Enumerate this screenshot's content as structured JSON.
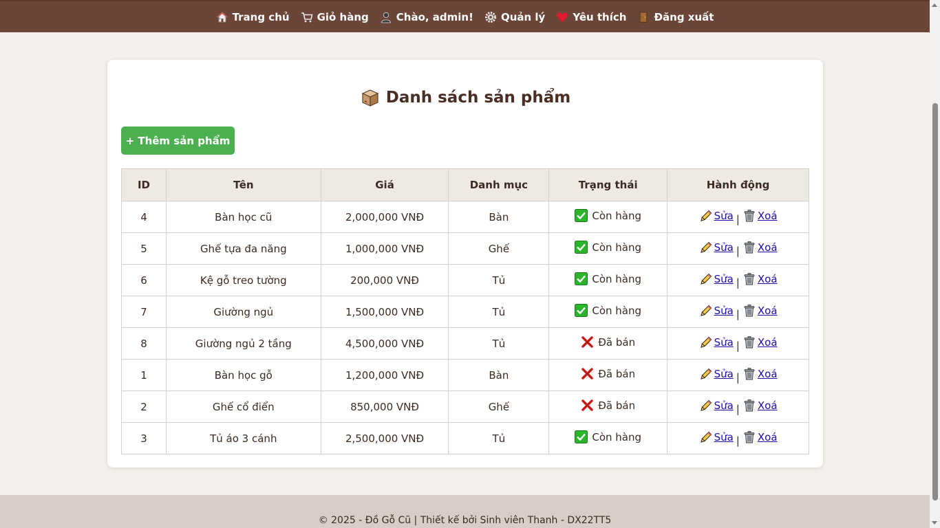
{
  "nav": {
    "items": [
      {
        "label": "Trang chủ",
        "icon": "house-icon"
      },
      {
        "label": "Giỏ hàng",
        "icon": "cart-icon"
      },
      {
        "label": "Chào, admin!",
        "icon": "user-icon"
      },
      {
        "label": "Quản lý",
        "icon": "gear-icon"
      },
      {
        "label": "Yêu thích",
        "icon": "heart-icon"
      },
      {
        "label": "Đăng xuất",
        "icon": "door-icon"
      }
    ]
  },
  "page": {
    "title": "Danh sách sản phẩm",
    "title_icon": "package-icon",
    "add_button_label": "+ Thêm sản phẩm"
  },
  "table": {
    "headers": [
      "ID",
      "Tên",
      "Giá",
      "Danh mục",
      "Trạng thái",
      "Hành động"
    ],
    "rows": [
      {
        "id": "4",
        "name": "Bàn học cũ",
        "price": "2,000,000 VNĐ",
        "category": "Bàn",
        "status": "Còn hàng",
        "status_icon": "check-icon"
      },
      {
        "id": "5",
        "name": "Ghế tựa đa năng",
        "price": "1,000,000 VNĐ",
        "category": "Ghế",
        "status": "Còn hàng",
        "status_icon": "check-icon"
      },
      {
        "id": "6",
        "name": "Kệ gỗ treo tường",
        "price": "200,000 VNĐ",
        "category": "Tủ",
        "status": "Còn hàng",
        "status_icon": "check-icon"
      },
      {
        "id": "7",
        "name": "Giường ngủ",
        "price": "1,500,000 VNĐ",
        "category": "Tủ",
        "status": "Còn hàng",
        "status_icon": "check-icon"
      },
      {
        "id": "8",
        "name": "Giường ngủ 2 tầng",
        "price": "4,500,000 VNĐ",
        "category": "Tủ",
        "status": "Đã bán",
        "status_icon": "cross-icon"
      },
      {
        "id": "1",
        "name": "Bàn học gỗ",
        "price": "1,200,000 VNĐ",
        "category": "Bàn",
        "status": "Đã bán",
        "status_icon": "cross-icon"
      },
      {
        "id": "2",
        "name": "Ghế cổ điển",
        "price": "850,000 VNĐ",
        "category": "Ghế",
        "status": "Đã bán",
        "status_icon": "cross-icon"
      },
      {
        "id": "3",
        "name": "Tủ áo 3 cánh",
        "price": "2,500,000 VNĐ",
        "category": "Tủ",
        "status": "Còn hàng",
        "status_icon": "check-icon"
      }
    ],
    "action_edit_label": "Sửa",
    "action_delete_label": "Xoá",
    "action_separator": "|"
  },
  "footer": {
    "text": "© 2025 - Đồ Gỗ Cũ | Thiết kế bởi Sinh viên Thanh - DX22TT5"
  },
  "colors": {
    "navbar": "#6b4538",
    "page_background": "#f3efea",
    "add_button": "#4caf50",
    "table_header": "#efe9e4",
    "footer": "#d8cdc7",
    "link": "#1a0dab"
  }
}
